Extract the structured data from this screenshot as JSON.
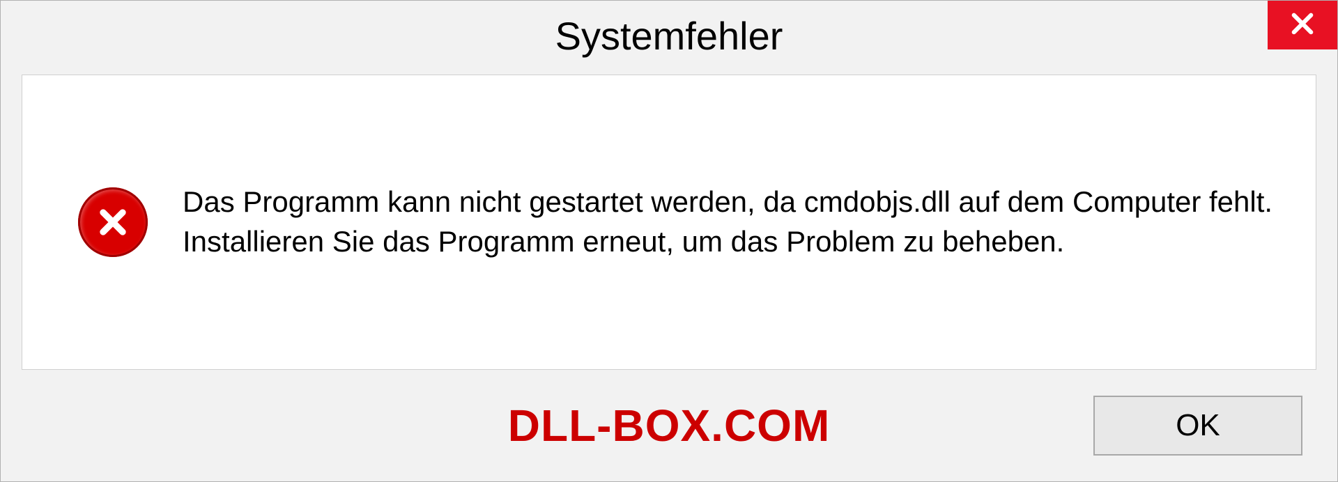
{
  "dialog": {
    "title": "Systemfehler",
    "message": "Das Programm kann nicht gestartet werden, da cmdobjs.dll auf dem Computer fehlt. Installieren Sie das Programm erneut, um das Problem zu beheben.",
    "ok_label": "OK",
    "watermark": "DLL-BOX.COM"
  }
}
